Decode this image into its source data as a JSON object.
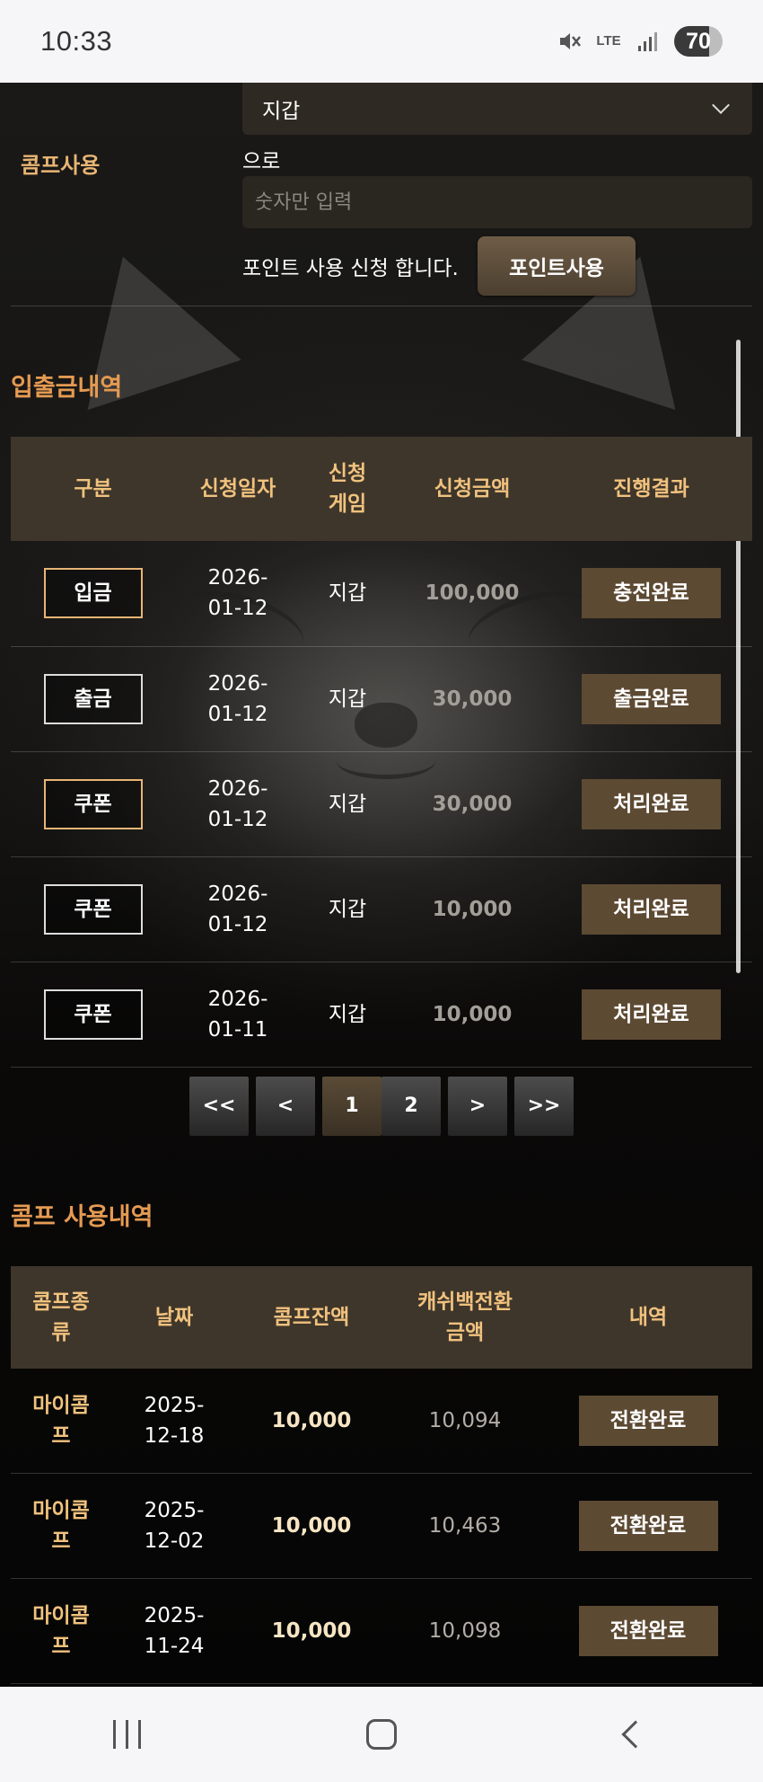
{
  "status_bar": {
    "time": "10:33",
    "network": "LTE",
    "battery": "70",
    "icons": [
      "mute-icon",
      "lte-icon",
      "signal-icon",
      "battery-icon"
    ]
  },
  "comp_form": {
    "label": "콤프사용",
    "wallet_select": "지갑",
    "to_text": "으로",
    "amount_placeholder": "숫자만 입력",
    "apply_text": "포인트 사용 신청 합니다.",
    "point_button": "포인트사용"
  },
  "deposit_history": {
    "title": "입출금내역",
    "headers": [
      "구분",
      "신청일자",
      "신청\n게임",
      "신청금액",
      "진행결과"
    ],
    "rows": [
      {
        "type": "입금",
        "date": "2026-\n01-12",
        "game": "지갑",
        "amount": "100,000",
        "status": "충전완료"
      },
      {
        "type": "출금",
        "date": "2026-\n01-12",
        "game": "지갑",
        "amount": "30,000",
        "status": "출금완료"
      },
      {
        "type": "쿠폰",
        "date": "2026-\n01-12",
        "game": "지갑",
        "amount": "30,000",
        "status": "처리완료"
      },
      {
        "type": "쿠폰",
        "date": "2026-\n01-12",
        "game": "지갑",
        "amount": "10,000",
        "status": "처리완료"
      },
      {
        "type": "쿠폰",
        "date": "2026-\n01-11",
        "game": "지갑",
        "amount": "10,000",
        "status": "처리완료"
      }
    ],
    "pagination": [
      "<<",
      "<",
      "1",
      "2",
      ">",
      ">>"
    ],
    "current_page": "1"
  },
  "comp_history": {
    "title": "콤프 사용내역",
    "headers": [
      "콤프종\n류",
      "날짜",
      "콤프잔액",
      "캐쉬백전환\n금액",
      "내역"
    ],
    "rows": [
      {
        "kind": "마이콤\n프",
        "date": "2025-\n12-18",
        "balance": "10,000",
        "cashback": "10,094",
        "status": "전환완료"
      },
      {
        "kind": "마이콤\n프",
        "date": "2025-\n12-02",
        "balance": "10,000",
        "cashback": "10,463",
        "status": "전환완료"
      },
      {
        "kind": "마이콤\n프",
        "date": "2025-\n11-24",
        "balance": "10,000",
        "cashback": "10,098",
        "status": "전환완료"
      }
    ]
  },
  "nav_bar": {
    "icons": [
      "recent-apps-icon",
      "home-icon",
      "back-icon"
    ]
  },
  "colors": {
    "accent_gold": "#e8b574",
    "section_title": "#e59a52",
    "header_bg": "#3e362b",
    "status_btn": "#5d4a33"
  }
}
